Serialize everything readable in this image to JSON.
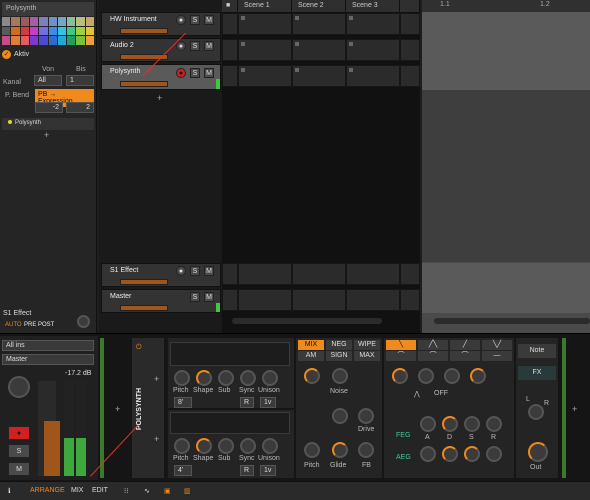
{
  "inspector": {
    "title": "Polysynth",
    "aktiv_label": "Aktiv",
    "von_label": "Von",
    "bis_label": "Bis",
    "kanal_label": "Kanal",
    "kanal_from": "All",
    "kanal_to": "1",
    "pbend_label": "P. Bend",
    "pbend_value": "PB → Expression",
    "pb_down": "-2",
    "pb_up": "2",
    "device_item": "Polysynth",
    "fx_title": "S1 Effect",
    "auto": "AUTO",
    "pre": "PRE",
    "post": "POST",
    "input": "All ins",
    "output": "Master",
    "db": "-17.2 dB",
    "s": "S",
    "m": "M"
  },
  "tracks": [
    {
      "name": "HW Instrument"
    },
    {
      "name": "Audio 2"
    },
    {
      "name": "Polysynth"
    },
    {
      "name": "S1 Effect"
    },
    {
      "name": "Master"
    }
  ],
  "scenes": [
    "Scene 1",
    "Scene 2",
    "Scene 3"
  ],
  "ruler": {
    "m1": "1.1",
    "m2": "1.2"
  },
  "device": {
    "name": "POLYSYNTH",
    "osc1": [
      "Pitch",
      "Shape",
      "Sub",
      "Sync",
      "Unison"
    ],
    "osc1_vals": [
      "8'",
      "R",
      "1v"
    ],
    "osc2": [
      "Pitch",
      "Shape",
      "Sub",
      "Sync",
      "Unison"
    ],
    "osc2_vals": [
      "4'",
      "R",
      "1v"
    ],
    "mix_tabs": [
      "MIX",
      "NEG",
      "WIPE",
      "AM",
      "SIGN",
      "MAX"
    ],
    "noise": "Noise",
    "drive": "Drive",
    "pitch": "Pitch",
    "glide": "Glide",
    "fb": "FB",
    "off": "OFF",
    "feg": "FEG",
    "aeg": "AEG",
    "adsr": [
      "A",
      "D",
      "S",
      "R"
    ],
    "note": "Note",
    "fx": "FX",
    "out": "Out",
    "L": "L",
    "R": "R"
  },
  "bottom": {
    "arrange": "ARRANGE",
    "mix": "MIX",
    "edit": "EDIT"
  }
}
